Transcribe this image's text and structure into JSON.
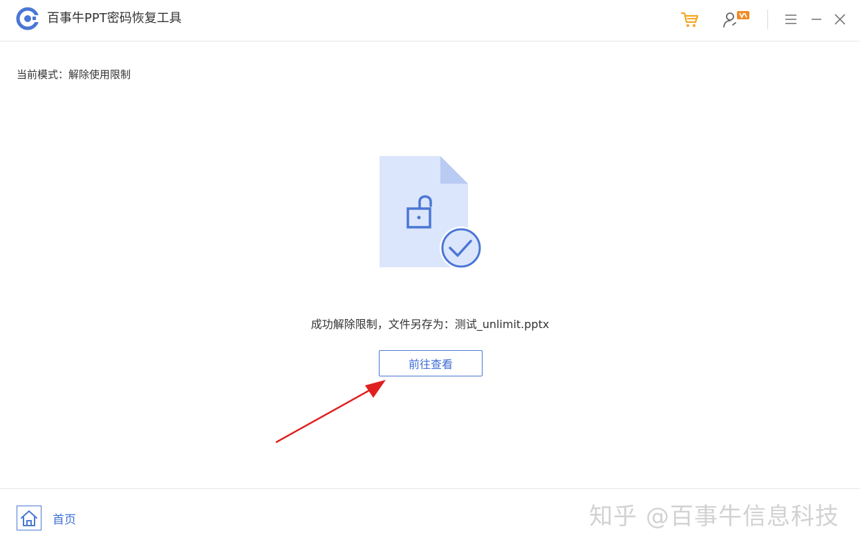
{
  "app": {
    "title": "百事牛PPT密码恢复工具"
  },
  "mode": {
    "text": "当前模式：解除使用限制"
  },
  "result": {
    "message": "成功解除限制，文件另存为：测试_unlimit.pptx",
    "open_button_label": "前往查看"
  },
  "footer": {
    "home_label": "首页",
    "watermark": "知乎 @百事牛信息科技"
  },
  "icons": {
    "logo": "app-logo",
    "cart": "shopping-cart-icon",
    "user": "user-vip-icon",
    "menu": "hamburger-menu-icon",
    "minimize": "minimize-icon",
    "close": "close-icon",
    "home": "home-icon",
    "file": "unlocked-file-success-illustration"
  },
  "colors": {
    "accent": "#3f6ed6",
    "cart": "#f5a623",
    "vip_badge": "#f08a24",
    "illustration_fill": "#dbe5fb",
    "illustration_fold": "#b9cbf3",
    "annotation_arrow": "#e02020"
  }
}
